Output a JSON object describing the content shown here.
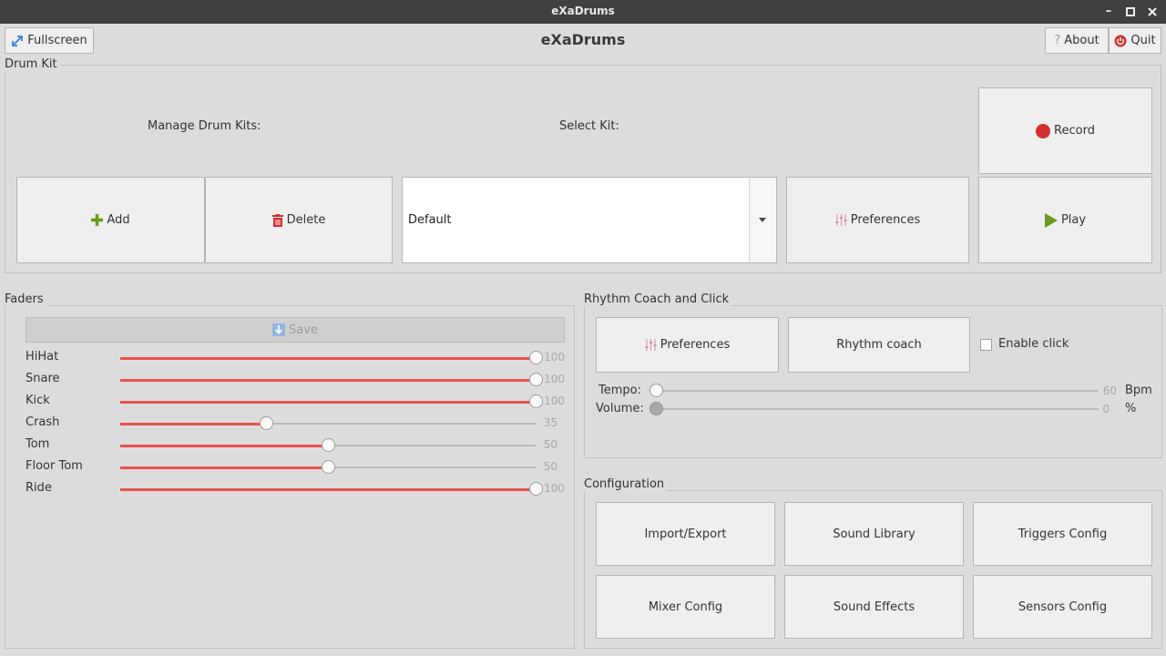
{
  "window": {
    "title": "eXaDrums",
    "minimize_icon": "minimize-icon",
    "maximize_icon": "maximize-icon",
    "close_icon": "close-icon"
  },
  "header": {
    "fullscreen_label": "Fullscreen",
    "app_title": "eXaDrums",
    "about_label": "About",
    "quit_label": "Quit"
  },
  "drum_kit": {
    "group_label": "Drum Kit",
    "manage_label": "Manage Drum Kits:",
    "select_label": "Select Kit:",
    "add_label": "Add",
    "delete_label": "Delete",
    "selected_kit": "Default",
    "preferences_label": "Preferences",
    "record_label": "Record",
    "play_label": "Play"
  },
  "faders": {
    "group_label": "Faders",
    "save_label": "Save",
    "items": [
      {
        "name": "HiHat",
        "value": "100",
        "level": 100
      },
      {
        "name": "Snare",
        "value": "100",
        "level": 100
      },
      {
        "name": "Kick",
        "value": "100",
        "level": 100
      },
      {
        "name": "Crash",
        "value": "35",
        "level": 35
      },
      {
        "name": "Tom",
        "value": "50",
        "level": 50
      },
      {
        "name": "Floor Tom",
        "value": "50",
        "level": 50
      },
      {
        "name": "Ride",
        "value": "100",
        "level": 100
      }
    ]
  },
  "rhythm": {
    "group_label": "Rhythm Coach and Click",
    "preferences_label": "Preferences",
    "rhythm_coach_label": "Rhythm coach",
    "enable_click_label": "Enable click",
    "enable_click_checked": false,
    "tempo_label": "Tempo:",
    "tempo_value": "60",
    "tempo_unit": "Bpm",
    "tempo_level": 0,
    "volume_label": "Volume:",
    "volume_value": "0",
    "volume_unit": "%",
    "volume_level": 0
  },
  "configuration": {
    "group_label": "Configuration",
    "buttons": [
      "Import/Export",
      "Sound Library",
      "Triggers Config",
      "Mixer Config",
      "Sound Effects",
      "Sensors Config"
    ]
  },
  "colors": {
    "accent_red": "#e5534b",
    "record_red": "#d42f2f",
    "add_green": "#6a9a1f",
    "quit_red": "#d42f2f"
  }
}
